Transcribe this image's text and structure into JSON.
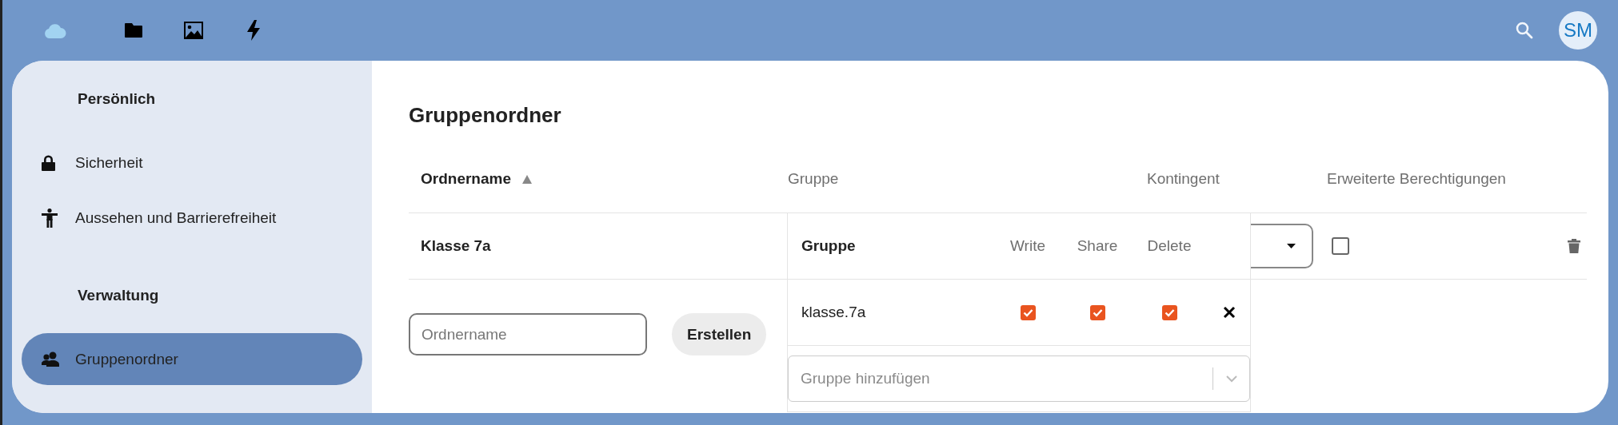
{
  "header": {
    "avatar": {
      "initials": "SM"
    }
  },
  "sidebar": {
    "sections": [
      {
        "heading": "Persönlich",
        "items": [
          {
            "label": "Sicherheit",
            "kind": "security",
            "selected": false
          },
          {
            "label": "Aussehen und Barrierefreiheit",
            "kind": "appearance",
            "selected": false
          }
        ]
      },
      {
        "heading": "Verwaltung",
        "items": [
          {
            "label": "Gruppenordner",
            "kind": "groupfolders",
            "selected": true
          }
        ]
      }
    ]
  },
  "main": {
    "title": "Gruppenordner",
    "table": {
      "columns": [
        {
          "label": "Ordnername",
          "sorted": true
        },
        {
          "label": "Gruppe",
          "sorted": false
        },
        {
          "label": "Kontingent",
          "sorted": false
        },
        {
          "label": "Erweiterte Berechtigungen",
          "sorted": false
        }
      ],
      "rows": [
        {
          "name": "Klasse 7a",
          "advanced_permissions": false
        }
      ]
    },
    "new_folder": {
      "placeholder": "Ordnername",
      "button": "Erstellen"
    },
    "group_popover": {
      "columns": [
        "Gruppe",
        "Write",
        "Share",
        "Delete"
      ],
      "groups": [
        {
          "name": "klasse.7a",
          "write": true,
          "share": true,
          "delete": true
        }
      ],
      "add_group": {
        "placeholder": "Gruppe hinzufügen"
      }
    }
  }
}
